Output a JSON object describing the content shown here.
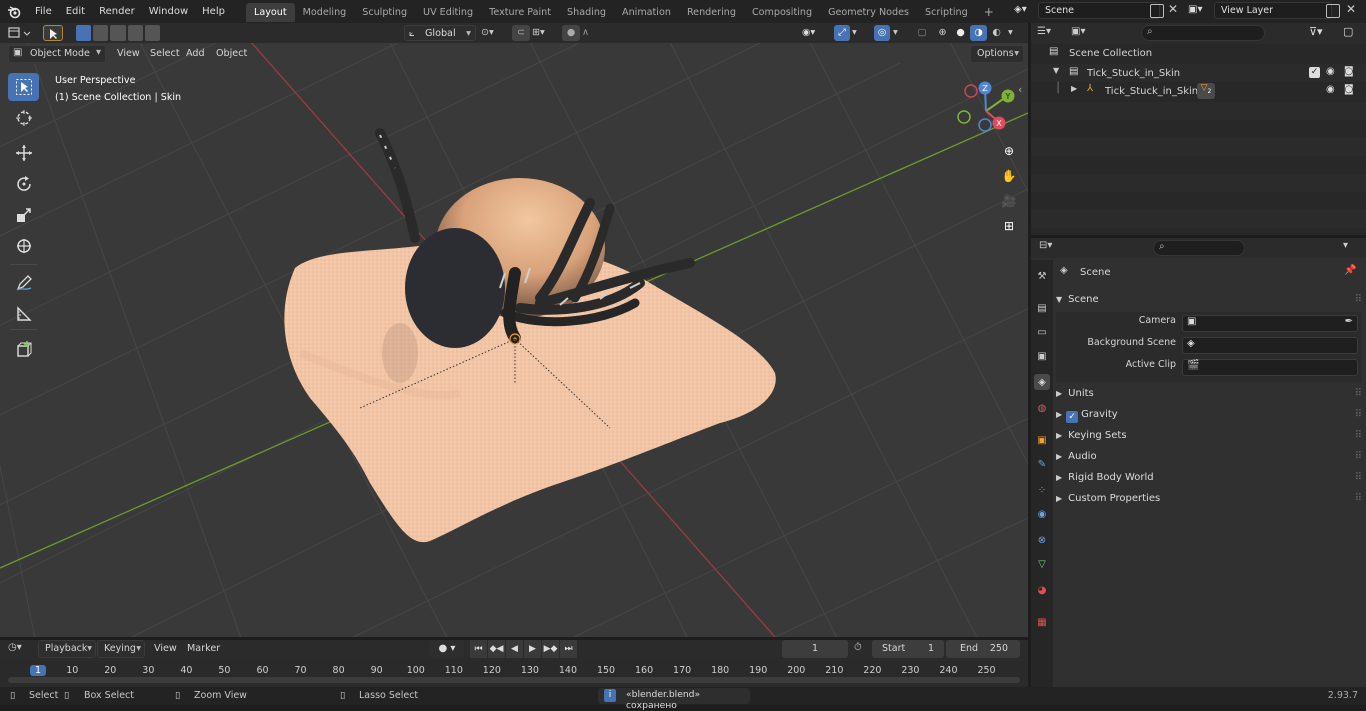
{
  "app": {
    "menus": [
      "File",
      "Edit",
      "Render",
      "Window",
      "Help"
    ],
    "workspace_tabs": [
      "Layout",
      "Modeling",
      "Sculpting",
      "UV Editing",
      "Texture Paint",
      "Shading",
      "Animation",
      "Rendering",
      "Compositing",
      "Geometry Nodes",
      "Scripting"
    ],
    "active_tab": "Layout",
    "add_tab": "+",
    "scene_name": "Scene",
    "view_layer": "View Layer"
  },
  "viewport_header": {
    "mode": "Object Mode",
    "menus": [
      "View",
      "Select",
      "Add",
      "Object"
    ],
    "orientation": "Global",
    "options": "Options"
  },
  "viewport": {
    "perspective": "User Perspective",
    "collection_info": "(1) Scene Collection | Skin",
    "gizmo_axes": {
      "x": "X",
      "y": "Y",
      "z": "Z"
    },
    "colors": {
      "bg": "#393939",
      "grid": "#444444",
      "x_axis": "#9d3a45",
      "y_axis": "#6e9a2c",
      "skin": "#f2c5a6"
    }
  },
  "outliner": {
    "root": "Scene Collection",
    "collection": "Tick_Stuck_in_Skin",
    "object": "Tick_Stuck_in_Skin",
    "object_badge": "2"
  },
  "properties": {
    "header": "Scene",
    "section": "Scene",
    "fields": [
      {
        "label": "Camera",
        "value": ""
      },
      {
        "label": "Background Scene",
        "value": ""
      },
      {
        "label": "Active Clip",
        "value": ""
      }
    ],
    "panels": [
      "Units",
      "Gravity",
      "Keying Sets",
      "Audio",
      "Rigid Body World",
      "Custom Properties"
    ],
    "gravity_checked": true
  },
  "timeline": {
    "menus": [
      "Playback",
      "Keying",
      "View",
      "Marker"
    ],
    "current_frame": "1",
    "start_label": "Start",
    "start": "1",
    "end_label": "End",
    "end": "250",
    "ruler": [
      "1",
      "10",
      "20",
      "30",
      "40",
      "50",
      "60",
      "70",
      "80",
      "90",
      "100",
      "110",
      "120",
      "130",
      "140",
      "150",
      "160",
      "170",
      "180",
      "190",
      "200",
      "210",
      "220",
      "230",
      "240",
      "250"
    ]
  },
  "statusbar": {
    "select": "Select",
    "box_select": "Box Select",
    "zoom_view": "Zoom View",
    "lasso_select": "Lasso Select",
    "message": "«blender.blend» сохранено",
    "version": "2.93.7"
  }
}
